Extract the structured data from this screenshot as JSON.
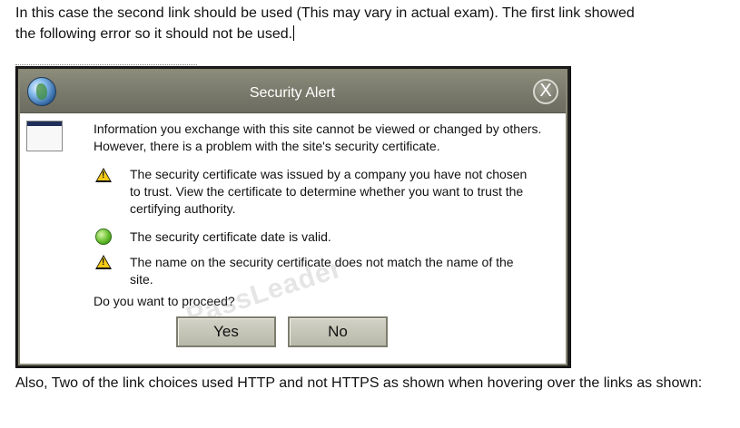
{
  "intro_text_line1": "In this case the second link should be used (This may vary in actual exam). The first link showed",
  "intro_text_line2": "the following error so it should not be used.",
  "dialog": {
    "title": "Security Alert",
    "close_label": "X",
    "intro": "Information you exchange with this site cannot be viewed or changed by others. However, there is a problem with the site's security certificate.",
    "items": [
      {
        "icon": "warning-icon",
        "text": "The security certificate was issued by a company you have not chosen to trust. View the certificate to determine whether you want to trust the certifying authority."
      },
      {
        "icon": "check-green-icon",
        "text": "The security certificate date is valid."
      },
      {
        "icon": "warning-icon",
        "text": "The name on the security certificate does not match the name of the site."
      }
    ],
    "question": "Do you want to proceed?",
    "yes_label": "Yes",
    "no_label": "No",
    "watermark": "PassLeader"
  },
  "outro_text": "Also, Two of the link choices used HTTP and not HTTPS as shown when hovering over the links as shown:"
}
